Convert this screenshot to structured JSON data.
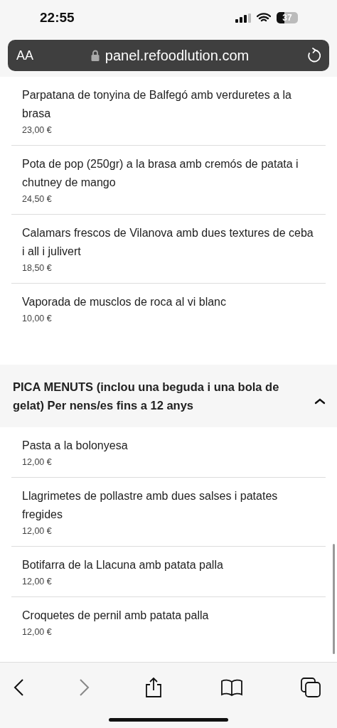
{
  "status_bar": {
    "time": "22:55",
    "battery": "37"
  },
  "address_bar": {
    "text_size": "AA",
    "url": "panel.refoodlution.com"
  },
  "items_before": [
    {
      "name": "Parpatana de tonyina de Balfegó amb verduretes a la brasa",
      "price": "23,00 €"
    },
    {
      "name": "Pota de pop (250gr) a la brasa amb cremós de patata i chutney de mango",
      "price": "24,50 €"
    },
    {
      "name": "Calamars frescos de Vilanova amb dues textures de ceba i all i julivert",
      "price": "18,50 €"
    },
    {
      "name": "Vaporada de musclos de roca al vi blanc",
      "price": "10,00 €"
    }
  ],
  "section": {
    "title": "PICA MENUTS (inclou una beguda i una bola de gelat) Per nens/es fins a 12 anys",
    "expanded": true,
    "items": [
      {
        "name": "Pasta a la bolonyesa",
        "price": "12,00 €"
      },
      {
        "name": "Llagrimetes de pollastre amb dues salses i patates fregides",
        "price": "12,00 €"
      },
      {
        "name": "Botifarra de la Llacuna amb patata palla",
        "price": "12,00 €"
      },
      {
        "name": "Croquetes de pernil amb patata palla",
        "price": "12,00 €"
      }
    ]
  },
  "toolbar": {
    "back_disabled": false,
    "forward_disabled": true
  }
}
